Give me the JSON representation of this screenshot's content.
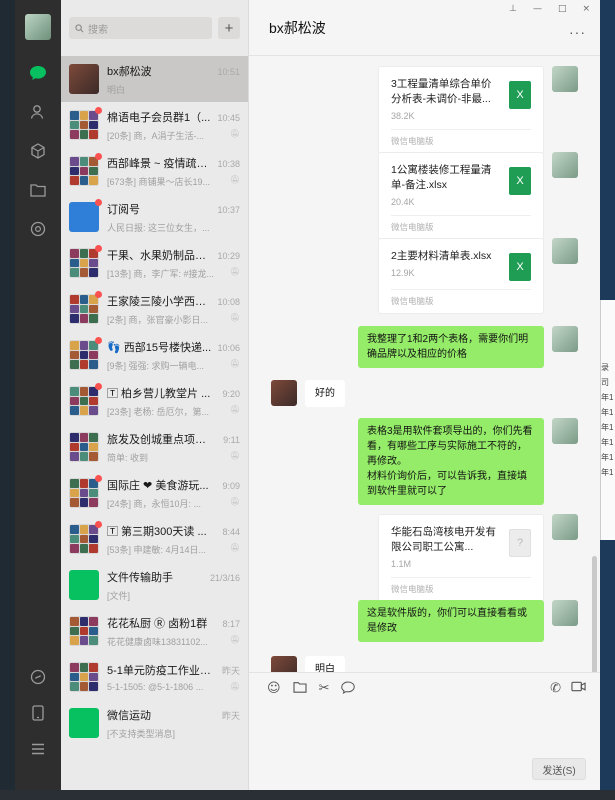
{
  "window": {
    "title": "bx郝松波",
    "controls": [
      "⊥",
      "—",
      "□",
      "×"
    ]
  },
  "search": {
    "placeholder": "搜索"
  },
  "chats": [
    {
      "name": "bx郝松波",
      "time": "10:51",
      "preview": "明白",
      "selected": true,
      "unread": false,
      "group": false,
      "muted": false
    },
    {
      "name": "棉语电子会员群1（...",
      "time": "10:45",
      "preview": "[20条] 商，A涓子生活-...",
      "unread": true,
      "group": true,
      "muted": true
    },
    {
      "name": "西部峰景 ~ 疫情疏菜...",
      "time": "10:38",
      "preview": "[673条] 商铺果～店长19...",
      "unread": true,
      "group": true,
      "muted": true
    },
    {
      "name": "订阅号",
      "time": "10:37",
      "preview": "人民日报: 这三位女生，...",
      "unread": true,
      "group": false,
      "muted": false
    },
    {
      "name": "干果、水果奶制品等...",
      "time": "10:29",
      "preview": "[13条] 商，李广军: #接龙...",
      "unread": true,
      "group": true,
      "muted": true
    },
    {
      "name": "王家陵三陵小学西小...",
      "time": "10:08",
      "preview": "[2条] 商，张官豪小影日...",
      "unread": true,
      "group": true,
      "muted": true
    },
    {
      "name": "👣 西部15号楼快递...",
      "time": "10:06",
      "preview": "[9条] 强强: 求购一辆电...",
      "unread": true,
      "group": true,
      "muted": true
    },
    {
      "name": "🅃 柏乡营儿教堂片 ...",
      "time": "9:20",
      "preview": "[23条] 老杨: 岳厄尔，第...",
      "unread": true,
      "group": true,
      "muted": true
    },
    {
      "name": "旅发及创城重点项目...",
      "time": "9:11",
      "preview": "简单: 收到",
      "unread": false,
      "group": true,
      "muted": true
    },
    {
      "name": "国际庄 ❤ 美食游玩...",
      "time": "9:09",
      "preview": "[24条] 商，永恒10月: ...",
      "unread": true,
      "group": true,
      "muted": true
    },
    {
      "name": "🅃 第三期300天读 ...",
      "time": "8:44",
      "preview": "[53条] 申建敏: 4月14日...",
      "unread": true,
      "group": true,
      "muted": true
    },
    {
      "name": "文件传输助手",
      "time": "21/3/16",
      "preview": "[文件]",
      "unread": false,
      "group": false,
      "muted": false
    },
    {
      "name": "花花私厨 Ⓡ 卤粉1群",
      "time": "8:17",
      "preview": "花花健康卤味13831102...",
      "unread": false,
      "group": true,
      "muted": true
    },
    {
      "name": "5-1单元防疫工作业主群",
      "time": "昨天",
      "preview": "5-1-1505: @5-1-1806 ...",
      "unread": false,
      "group": true,
      "muted": true
    },
    {
      "name": "微信运动",
      "time": "昨天",
      "preview": "[不支持类型消息]",
      "unread": false,
      "group": false,
      "muted": false
    }
  ],
  "messages": [
    {
      "type": "file",
      "from": "me",
      "name": "3工程量清单综合单价分析表-未调价-非最...",
      "size": "38.2K",
      "source": "微信电脑版",
      "icon": "X"
    },
    {
      "type": "file",
      "from": "me",
      "name": "1公寓楼装修工程量清单-备注.xlsx",
      "size": "20.4K",
      "source": "微信电脑版",
      "icon": "X"
    },
    {
      "type": "file",
      "from": "me",
      "name": "2主要材料清单表.xlsx",
      "size": "12.9K",
      "source": "微信电脑版",
      "icon": "X"
    },
    {
      "type": "text",
      "from": "me",
      "text": "我整理了1和2两个表格，需要你们明确品牌以及相应的价格"
    },
    {
      "type": "text",
      "from": "peer",
      "text": "好的"
    },
    {
      "type": "text",
      "from": "me",
      "text": "表格3是用软件套项导出的，你们先看看，有哪些工序与实际施工不符的，再修改。\n材料价询价后，可以告诉我，直接填到软件里就可以了"
    },
    {
      "type": "file",
      "from": "me",
      "name": "华能石岛湾核电开发有限公司职工公寓...",
      "size": "1.1M",
      "source": "微信电脑版",
      "icon": "?"
    },
    {
      "type": "text",
      "from": "me",
      "text": "这是软件版的，你们可以直接看看或是修改"
    },
    {
      "type": "text",
      "from": "peer",
      "text": "明白"
    }
  ],
  "composer": {
    "send_label": "发送(S)"
  },
  "colors": {
    "accent": "#07c160",
    "my_bubble": "#95ec69",
    "rail": "#2e2e2e",
    "unread_dot": "#fa5151",
    "excel": "#1f9d55"
  },
  "background_window": {
    "lines": [
      "录",
      "司",
      "年1",
      "年1",
      "年1",
      "年1",
      "年1",
      "年1"
    ]
  }
}
